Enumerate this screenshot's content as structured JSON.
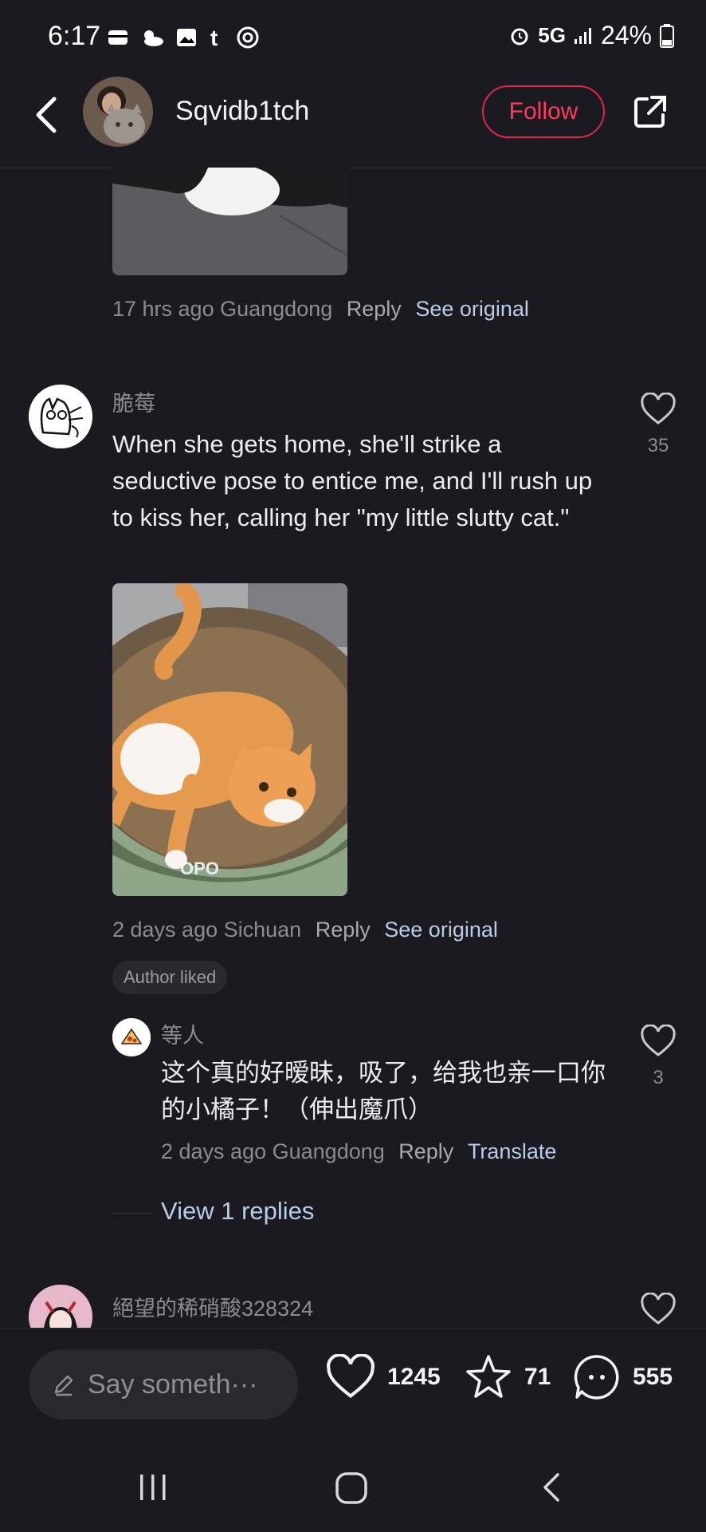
{
  "status_bar": {
    "time": "6:17",
    "network": "5G",
    "battery": "24%"
  },
  "header": {
    "username": "Sqvidb1tch",
    "follow_label": "Follow"
  },
  "top_comment": {
    "meta_time": "17 hrs ago",
    "meta_location": "Guangdong",
    "reply_label": "Reply",
    "link_label": "See original"
  },
  "comments": [
    {
      "author": "脆莓",
      "text": "When she gets home, she'll strike a seductive pose to entice me, and I'll rush up to kiss her, calling her \"my little slutty cat.\"",
      "likes": "35",
      "meta_time": "2 days ago",
      "meta_location": "Sichuan",
      "reply_label": "Reply",
      "link_label": "See original",
      "badge": "Author liked",
      "image_text": "OPO"
    }
  ],
  "reply": {
    "author": "等人",
    "text": "这个真的好暧昧，吸了，给我也亲一口你的小橘子！（伸出魔爪）",
    "likes": "3",
    "meta_time": "2 days ago",
    "meta_location": "Guangdong",
    "reply_label": "Reply",
    "link_label": "Translate"
  },
  "view_replies": "View 1 replies",
  "next_comment": {
    "author": "絕望的稀硝酸328324"
  },
  "bottom_bar": {
    "input_placeholder": "Say someth···",
    "likes": "1245",
    "stars": "71",
    "comments": "555"
  },
  "colors": {
    "background": "#1b1a20",
    "accent": "#ff3c5f",
    "link": "#b9cde6"
  }
}
